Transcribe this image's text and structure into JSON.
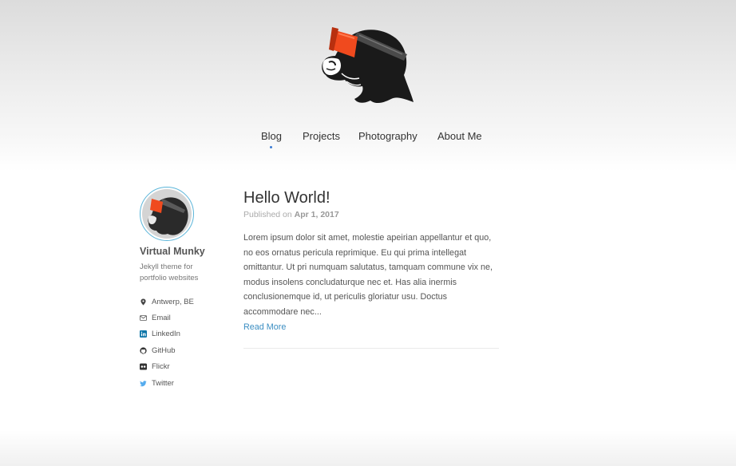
{
  "nav": {
    "items": [
      {
        "label": "Blog",
        "active": true
      },
      {
        "label": "Projects",
        "active": false
      },
      {
        "label": "Photography",
        "active": false
      },
      {
        "label": "About Me",
        "active": false
      }
    ]
  },
  "sidebar": {
    "name": "Virtual Munky",
    "bio": "Jekyll theme for portfolio websites",
    "links": [
      {
        "icon": "map-pin-icon",
        "label": "Antwerp, BE"
      },
      {
        "icon": "envelope-icon",
        "label": "Email"
      },
      {
        "icon": "linkedin-icon",
        "label": "LinkedIn"
      },
      {
        "icon": "github-icon",
        "label": "GitHub"
      },
      {
        "icon": "flickr-icon",
        "label": "Flickr"
      },
      {
        "icon": "twitter-icon",
        "label": "Twitter"
      }
    ]
  },
  "post": {
    "title": "Hello World!",
    "meta_prefix": "Published on",
    "date": "Apr 1, 2017",
    "excerpt": "Lorem ipsum dolor sit amet, molestie apeirian appellantur et quo, no eos ornatus pericula reprimique. Eu qui prima intellegat omittantur. Ut pri numquam salutatus, tamquam commune vix ne, modus insolens concludaturque nec et. Has alia inermis conclusionemque id, ut periculis gloriatur usu. Doctus accommodare nec...",
    "read_more": "Read More"
  },
  "colors": {
    "accent": "#3a7bd5",
    "link": "#3b8ec2",
    "goggles": "#f04a1e",
    "avatar_ring": "#5bb5d9",
    "twitter": "#55acee",
    "linkedin": "#0e76a8"
  }
}
